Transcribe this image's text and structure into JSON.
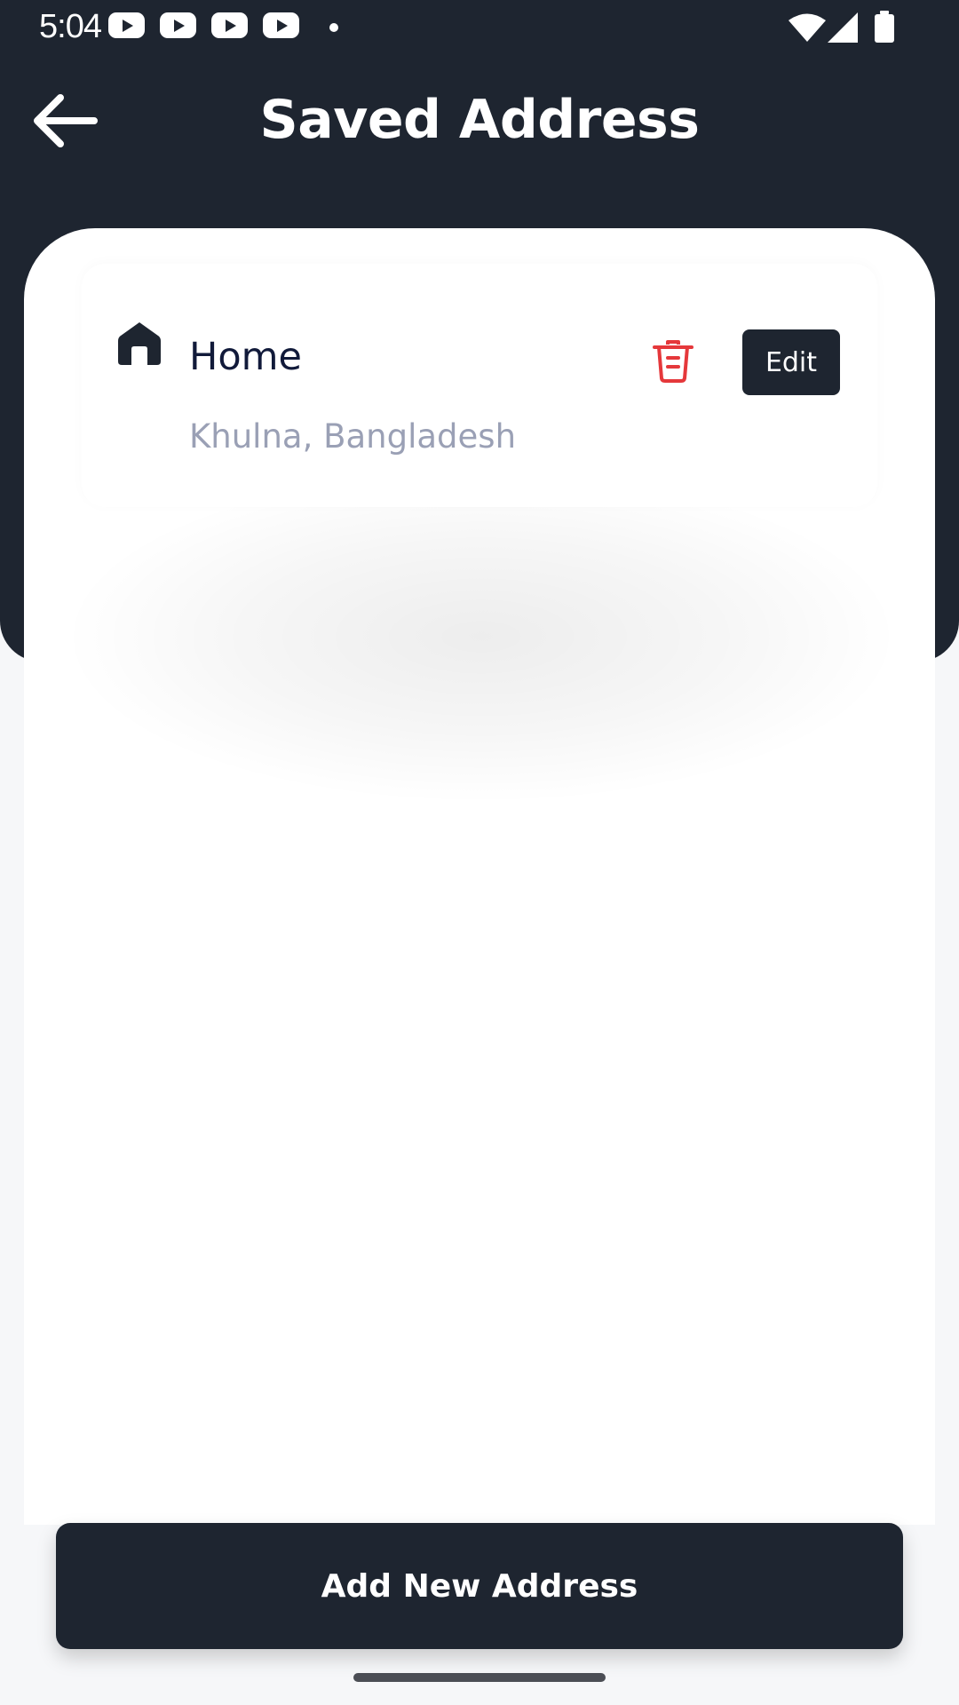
{
  "status_bar": {
    "time": "5:04",
    "notification_icons": [
      "youtube-icon",
      "youtube-icon",
      "youtube-icon",
      "youtube-icon",
      "dot-icon"
    ],
    "system_icons": [
      "wifi-icon",
      "signal-icon",
      "battery-icon"
    ]
  },
  "app_bar": {
    "back_icon": "arrow-left-icon",
    "title": "Saved Address"
  },
  "addresses": [
    {
      "icon": "home-icon",
      "label": "Home",
      "address": "Khulna, Bangladesh",
      "delete_icon": "trash-icon",
      "edit_label": "Edit"
    }
  ],
  "footer": {
    "add_button_label": "Add New Address"
  },
  "colors": {
    "primary_dark": "#1e2530",
    "delete_red": "#e5383b",
    "label_text": "#111a3a",
    "secondary_text": "#9aa0b5",
    "background": "#f6f7f9"
  }
}
